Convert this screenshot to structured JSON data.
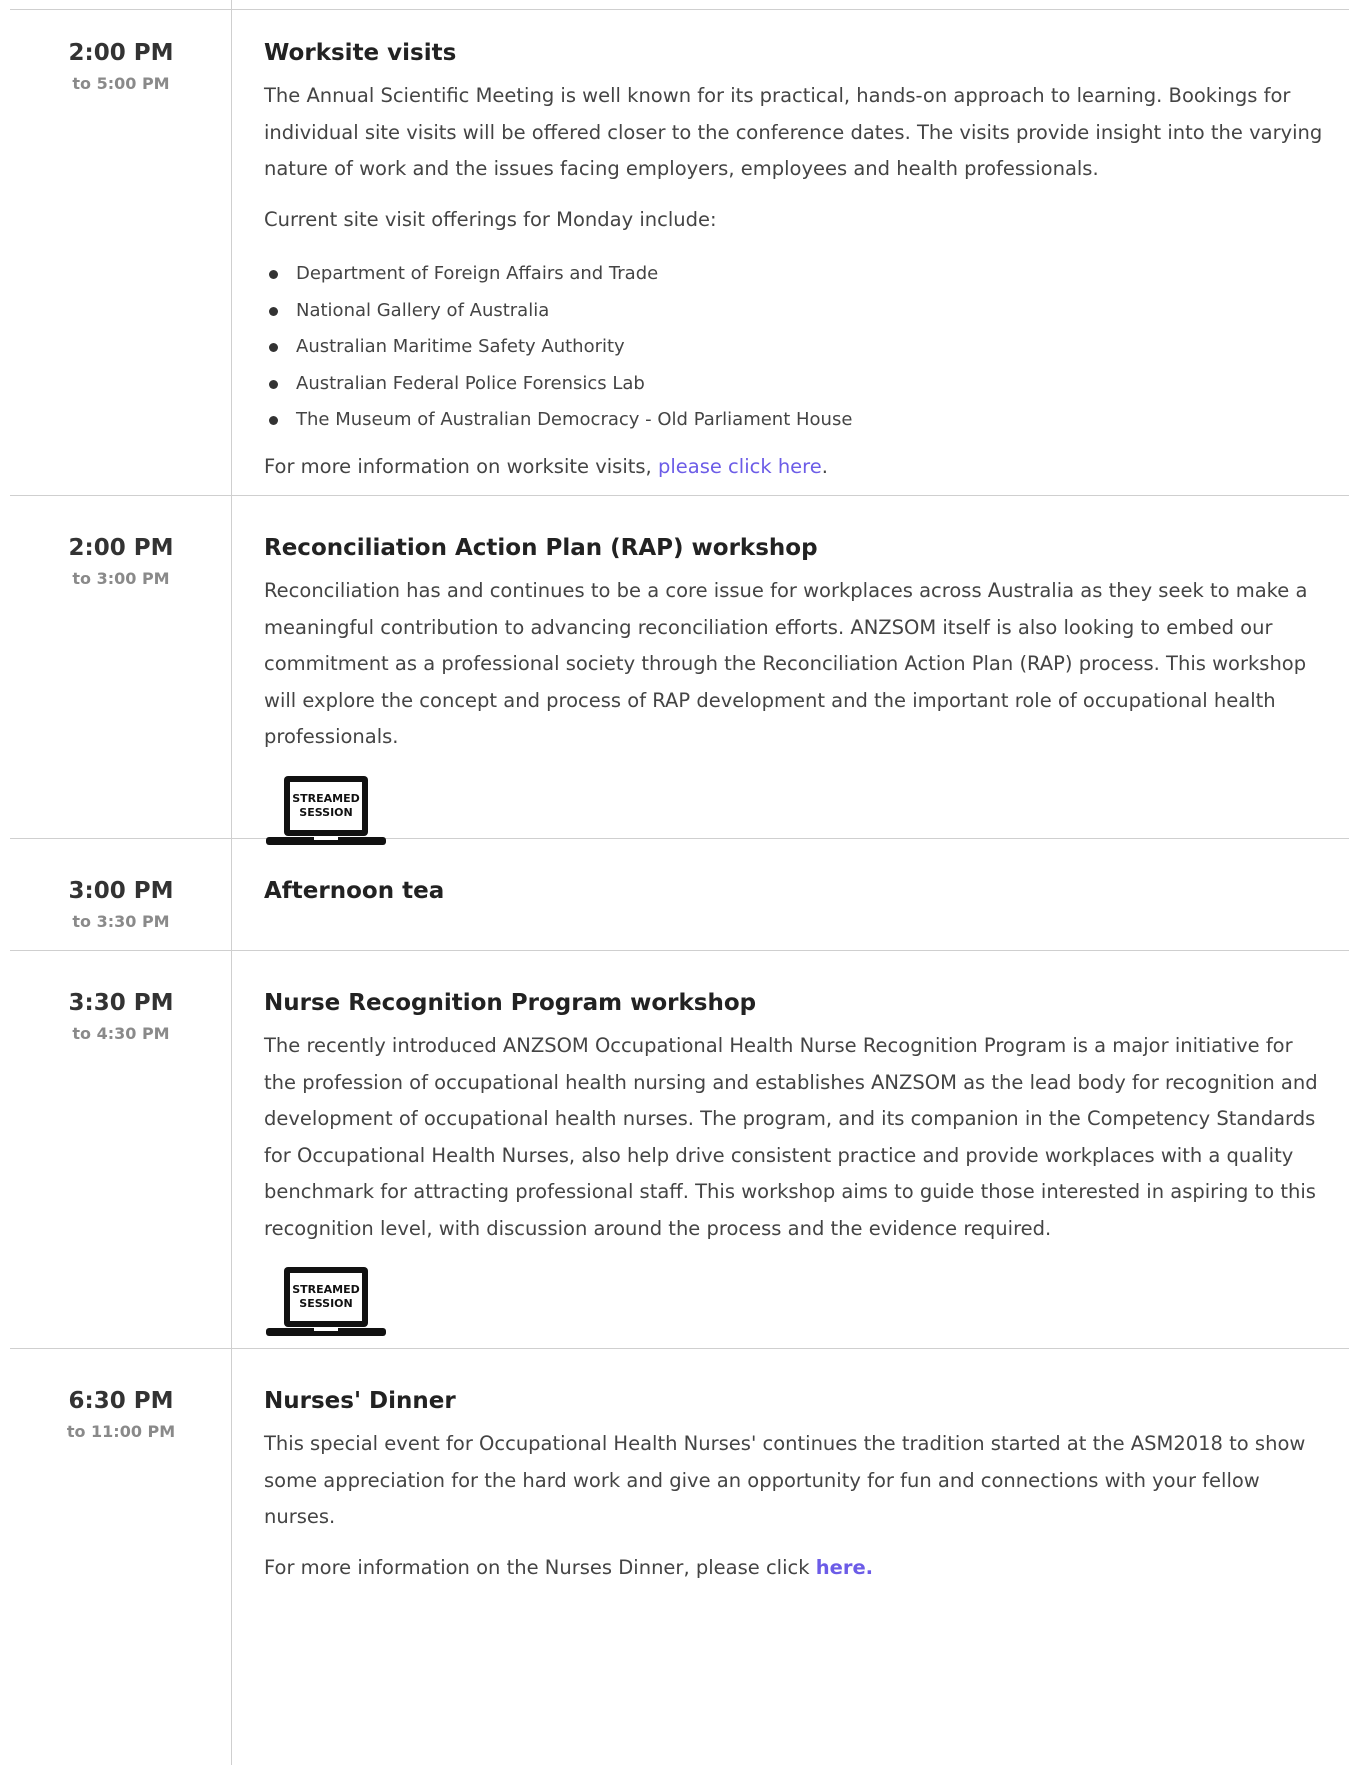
{
  "colors": {
    "link": "#6c5ce7",
    "divider": "#cfcfcf",
    "end_time": "#8a8a8a"
  },
  "sessions": [
    {
      "start": "2:00 PM",
      "end": "to 5:00 PM",
      "title": "Worksite visits",
      "paragraphs": [
        "The Annual Scientific Meeting is well known for its practical, hands-on approach to learning. Bookings for individual site visits will be offered closer to the conference dates. The visits provide insight into the varying nature of work and the issues facing employers, employees and health professionals.",
        "Current site visit offerings for Monday include:"
      ],
      "offerings": [
        "Department of Foreign Affairs and Trade",
        "National Gallery of Australia",
        "Australian Maritime Safety Authority",
        "Australian Federal Police Forensics Lab",
        "The Museum of Australian Democracy - Old Parliament House"
      ],
      "more_prefix": "For more information on worksite visits, ",
      "more_link": "please click here",
      "more_suffix": "."
    },
    {
      "start": "2:00 PM",
      "end": "to 3:00 PM",
      "title": "Reconciliation Action Plan (RAP) workshop",
      "paragraphs": [
        "Reconciliation has and continues to be a core issue for workplaces across Australia as they seek to make a meaningful contribution to advancing reconciliation efforts. ANZSOM itself is also looking to embed our commitment as a professional society through the Reconciliation Action Plan (RAP) process. This workshop will explore the concept and process of RAP development and the important role of occupational health professionals."
      ],
      "badge_line1": "STREAMED",
      "badge_line2": "SESSION",
      "badge_icon": "streamed-session-laptop-icon"
    },
    {
      "start": "3:00 PM",
      "end": "to 3:30 PM",
      "title": "Afternoon tea"
    },
    {
      "start": "3:30 PM",
      "end": "to 4:30 PM",
      "title": "Nurse Recognition Program workshop",
      "paragraphs": [
        "The recently introduced ANZSOM Occupational Health Nurse Recognition Program is a major initiative for the profession of occupational health nursing and establishes ANZSOM as the lead body for recognition and development of occupational health nurses. The program, and its companion in the Competency Standards for Occupational Health Nurses, also help drive consistent practice and provide workplaces with a quality benchmark for attracting professional staff. This workshop aims to guide those interested in aspiring to this recognition level, with discussion around the process and the evidence required."
      ],
      "badge_line1": "STREAMED",
      "badge_line2": "SESSION",
      "badge_icon": "streamed-session-laptop-icon"
    },
    {
      "start": "6:30 PM",
      "end": "to 11:00 PM",
      "title": "Nurses' Dinner",
      "paragraphs": [
        "This special event for Occupational Health Nurses' continues the tradition started at the ASM2018 to show some appreciation for the hard work and give an opportunity for fun and connections with your fellow nurses."
      ],
      "more_prefix": "For more information on the Nurses Dinner, please click ",
      "more_link": "here."
    }
  ]
}
